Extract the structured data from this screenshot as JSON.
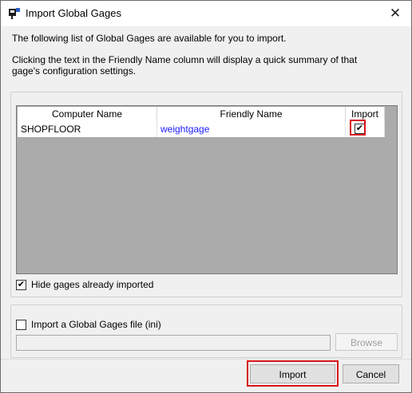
{
  "window": {
    "title": "Import Global Gages",
    "close_glyph": "✕"
  },
  "intro": {
    "line1": "The following list of Global Gages are available for you to import.",
    "line2": "Clicking the text in the Friendly Name column will display a quick summary of that gage's configuration settings."
  },
  "grid": {
    "columns": [
      "Computer Name",
      "Friendly Name",
      "Import"
    ],
    "rows": [
      {
        "computer_name": "SHOPFLOOR",
        "friendly_name": "weightgage",
        "import_checked": true,
        "check_glyph": "✔"
      }
    ],
    "link_color": "#1a1aff"
  },
  "options": {
    "hide_imported_label": "Hide gages already imported",
    "hide_imported_checked": true,
    "hide_check_glyph": "✔",
    "ini_import_label": "Import a Global Gages file (ini)",
    "ini_import_checked": false,
    "ini_path_value": ""
  },
  "buttons": {
    "browse": "Browse",
    "import": "Import",
    "cancel": "Cancel"
  },
  "colors": {
    "highlight": "#d8141b",
    "grid_background": "#ababab"
  }
}
